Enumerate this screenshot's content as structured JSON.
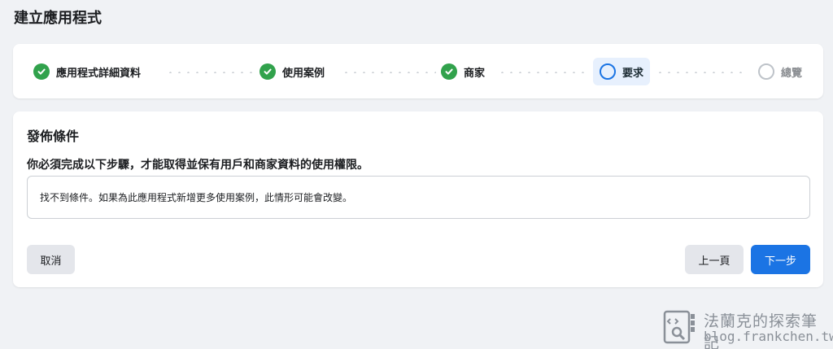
{
  "page": {
    "title": "建立應用程式"
  },
  "stepper": {
    "steps": [
      {
        "label": "應用程式詳細資料",
        "state": "done"
      },
      {
        "label": "使用案例",
        "state": "done"
      },
      {
        "label": "商家",
        "state": "done"
      },
      {
        "label": "要求",
        "state": "current"
      },
      {
        "label": "總覽",
        "state": "pending"
      }
    ]
  },
  "section": {
    "title": "發佈條件",
    "description": "你必須完成以下步驟，才能取得並保有用戶和商家資料的使用權限。",
    "notice": "找不到條件。如果為此應用程式新增更多使用案例，此情形可能會改變。"
  },
  "buttons": {
    "cancel": "取消",
    "previous": "上一頁",
    "next": "下一步"
  },
  "watermark": {
    "title": "法蘭克的探索筆記",
    "url": "blog.frankchen.tw"
  },
  "colors": {
    "accent": "#1b74e4",
    "success": "#31a24c",
    "background": "#f0f2f5"
  }
}
